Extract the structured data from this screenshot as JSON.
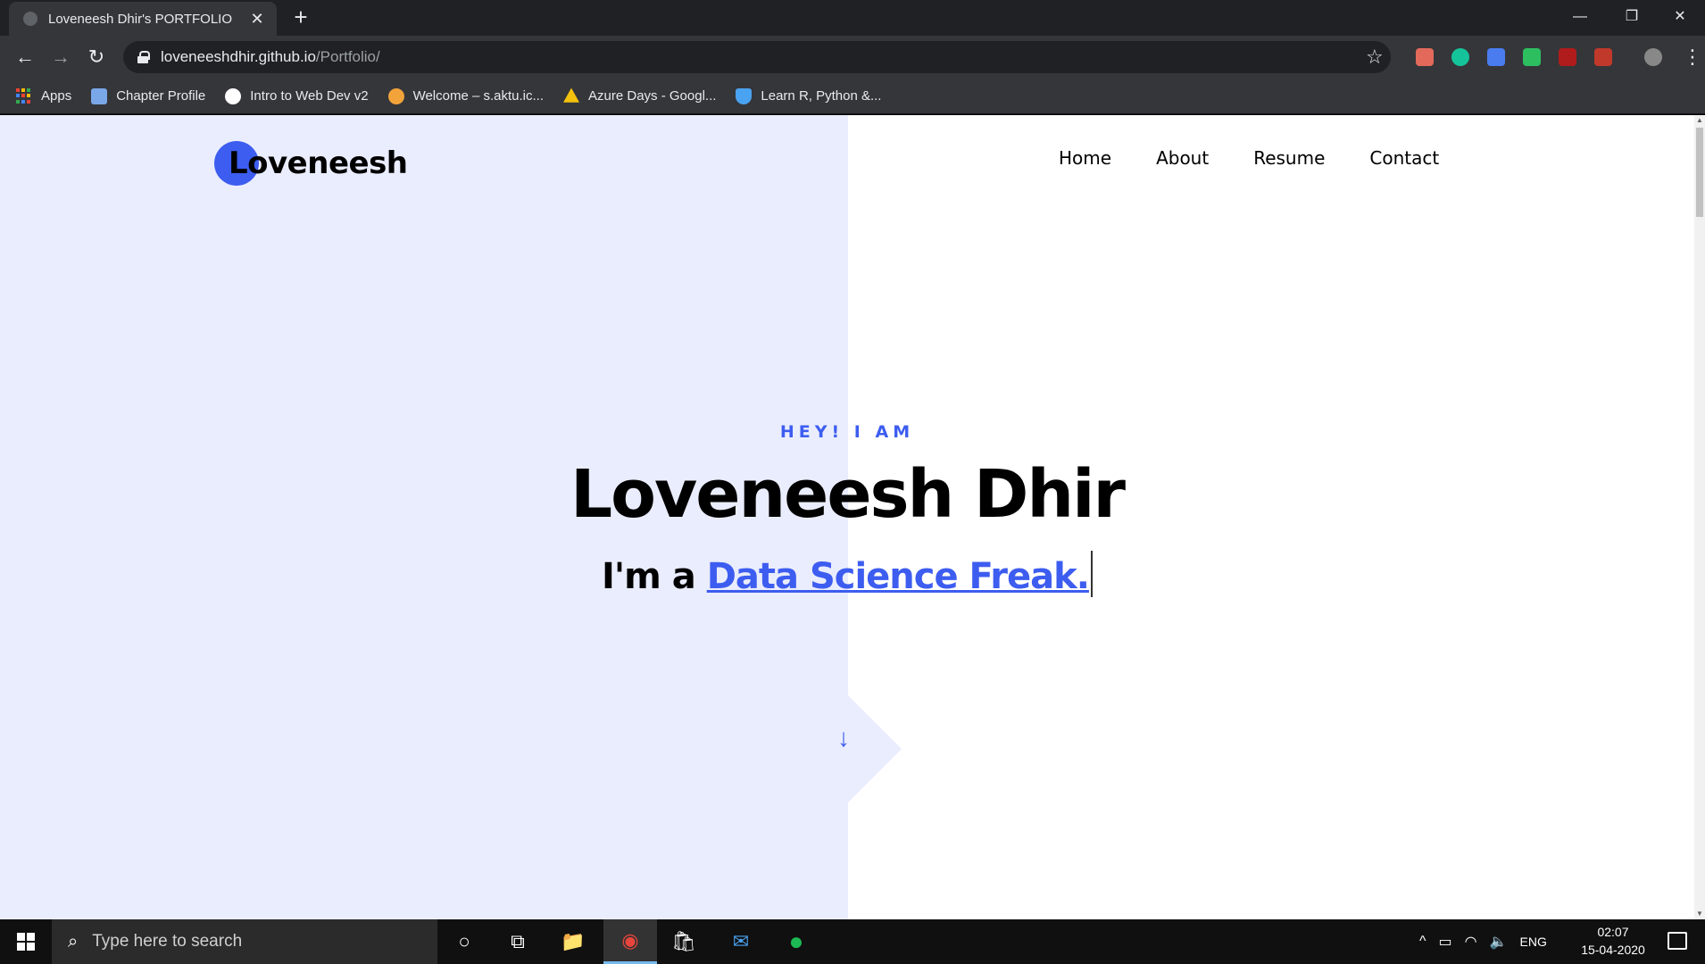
{
  "browser": {
    "tab": {
      "title": "Loveneesh Dhir's PORTFOLIO",
      "close": "✕"
    },
    "new_tab": "+",
    "window": {
      "minimize": "—",
      "restore": "❐",
      "close": "✕"
    },
    "url": {
      "host": "loveneeshdhir.github.io",
      "path": "/Portfolio/"
    },
    "nav": {
      "back": "←",
      "forward": "→",
      "reload": "↻"
    },
    "star": "☆",
    "menu": "⋮",
    "bookmarks": [
      {
        "label": "Apps",
        "icon": "apps-grid-icon"
      },
      {
        "label": "Chapter Profile",
        "icon": "chapter-icon",
        "color": "#7aa7e8"
      },
      {
        "label": "Intro to Web Dev v2",
        "icon": "globe-icon",
        "color": "#ffffff"
      },
      {
        "label": "Welcome – s.aktu.ic...",
        "icon": "aktu-icon",
        "color": "#f2a33a"
      },
      {
        "label": "Azure Days - Googl...",
        "icon": "drive-icon",
        "color": "#f4c20d"
      },
      {
        "label": "Learn R, Python &...",
        "icon": "shield-icon",
        "color": "#4aa3f0"
      }
    ],
    "extensions": [
      {
        "icon": "extension-icon",
        "color": "#e36a5a"
      },
      {
        "icon": "grammarly-icon",
        "color": "#15c39a"
      },
      {
        "icon": "graduation-cap-icon",
        "color": "#4a7cf0"
      },
      {
        "icon": "evernote-icon",
        "color": "#2dbe60"
      },
      {
        "icon": "ublock-icon",
        "color": "#b01c1c"
      },
      {
        "icon": "book-icon",
        "color": "#c0392b"
      },
      {
        "icon": "profile-avatar-icon",
        "color": "#888888"
      }
    ]
  },
  "site": {
    "logo": "Loveneesh",
    "nav": [
      "Home",
      "About",
      "Resume",
      "Contact"
    ],
    "hero": {
      "kicker": "HEY! I AM",
      "name": "Loveneesh Dhir",
      "role_prefix": "I'm a ",
      "role_highlight": "Data Science Freak."
    },
    "scroll_arrow": "↓",
    "colors": {
      "accent": "#3d5df0",
      "panel": "#eaedfd"
    }
  },
  "taskbar": {
    "search_placeholder": "Type here to search",
    "apps": [
      {
        "name": "cortana",
        "glyph": "○"
      },
      {
        "name": "task-view",
        "glyph": "⧉"
      },
      {
        "name": "file-explorer",
        "glyph": "📁"
      },
      {
        "name": "chrome",
        "glyph": "◉",
        "active": true
      },
      {
        "name": "store",
        "glyph": "🛍"
      },
      {
        "name": "mail",
        "glyph": "✉"
      },
      {
        "name": "spotify",
        "glyph": "●"
      }
    ],
    "tray": {
      "chevron": "^",
      "battery": "▭",
      "wifi": "◠",
      "volume": "🔈",
      "lang": "ENG"
    },
    "time": "02:07",
    "date": "15-04-2020"
  }
}
